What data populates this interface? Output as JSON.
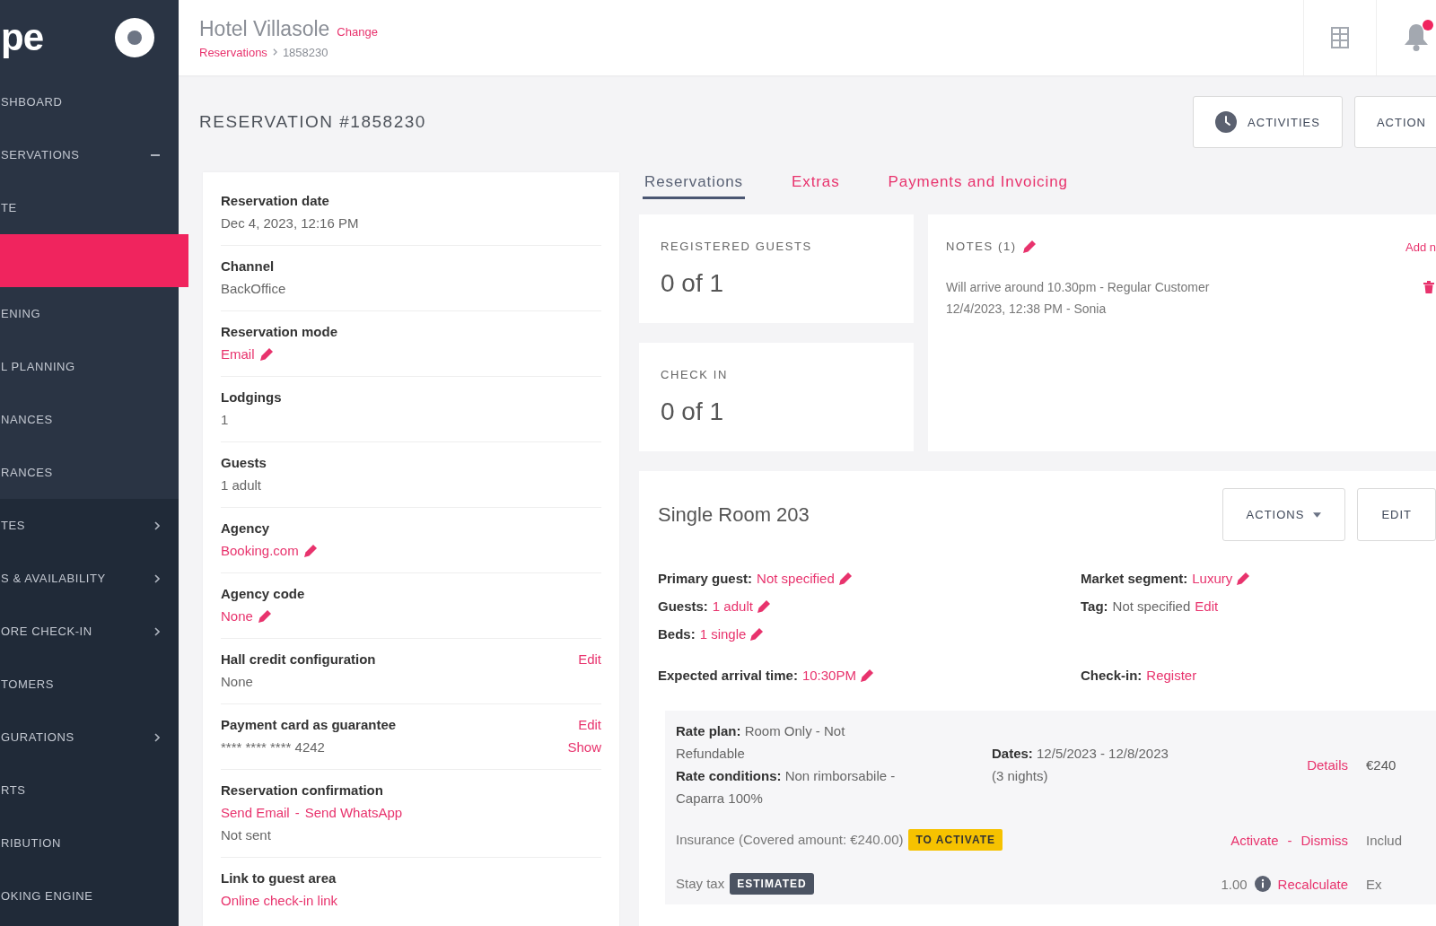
{
  "sidebar": {
    "logo": "pe",
    "items": [
      {
        "label": "SHBOARD",
        "kind": "link",
        "selected": false
      },
      {
        "label": "SERVATIONS",
        "kind": "group",
        "expanded": true,
        "selected": false,
        "children": [
          {
            "label": "TE",
            "selected": false
          },
          {
            "selected": true
          },
          {
            "label": "ENING",
            "selected": false
          },
          {
            "label": "L PLANNING",
            "selected": false
          },
          {
            "label": "NANCES",
            "selected": false
          },
          {
            "label": "RANCES",
            "selected": false
          }
        ]
      },
      {
        "label": "TES",
        "kind": "group",
        "expanded": false,
        "selected": false
      },
      {
        "label": "S & AVAILABILITY",
        "kind": "group",
        "expanded": false,
        "selected": false
      },
      {
        "label": "ORE CHECK-IN",
        "kind": "group",
        "expanded": false,
        "selected": false
      },
      {
        "label": "TOMERS",
        "kind": "link",
        "selected": false
      },
      {
        "label": "GURATIONS",
        "kind": "group",
        "expanded": false,
        "selected": false
      },
      {
        "label": "RTS",
        "kind": "link",
        "selected": false
      },
      {
        "label": "RIBUTION",
        "kind": "link",
        "selected": false
      },
      {
        "label": "OKING ENGINE",
        "kind": "link",
        "selected": false
      }
    ]
  },
  "header": {
    "hotel_name": "Hotel Villasole",
    "change_link": "Change",
    "breadcrumb": [
      {
        "label": "Reservations",
        "kind": "link"
      },
      {
        "label": "1858230",
        "kind": "current"
      }
    ]
  },
  "title": "RESERVATION #1858230",
  "title_buttons": [
    {
      "label": "ACTIVITIES",
      "kind": "activities"
    },
    {
      "label": "ACTION",
      "kind": "actions"
    }
  ],
  "details": [
    {
      "label": "Reservation date",
      "value": "Dec 4, 2023, 12:16 PM",
      "kind": "text"
    },
    {
      "label": "Channel",
      "value": "BackOffice",
      "kind": "text"
    },
    {
      "label": "Reservation mode",
      "value": "Email",
      "kind": "editable"
    },
    {
      "label": "Lodgings",
      "value": "1",
      "kind": "text"
    },
    {
      "label": "Guests",
      "value": "1 adult",
      "kind": "text"
    },
    {
      "label": "Agency",
      "value": "Booking.com",
      "kind": "editable"
    },
    {
      "label": "Agency code",
      "value": "None",
      "kind": "editable"
    },
    {
      "label": "Hall credit configuration",
      "value": "None",
      "kind": "text",
      "actions": [
        "Edit"
      ]
    },
    {
      "label": "Payment card as guarantee",
      "value": "**** **** **** 4242",
      "kind": "text",
      "actions": [
        "Edit",
        "Show"
      ]
    },
    {
      "label": "Reservation confirmation",
      "kind": "links",
      "links": [
        "Send Email",
        "Send WhatsApp"
      ],
      "link_separator": "-",
      "value": "Not sent"
    },
    {
      "label": "Link to guest area",
      "kind": "links",
      "links": [
        "Online check-in link"
      ]
    }
  ],
  "tabs": [
    {
      "label": "Reservations",
      "selected": true
    },
    {
      "label": "Extras",
      "selected": false
    },
    {
      "label": "Payments and Invoicing",
      "selected": false
    }
  ],
  "stats": [
    {
      "title": "REGISTERED GUESTS",
      "value": "0 of 1"
    },
    {
      "title": "CHECK IN",
      "value": "0 of 1"
    }
  ],
  "notes": {
    "title": "NOTES (1)",
    "add_link": "Add n",
    "items": [
      {
        "text": "Will arrive around 10.30pm - Regular Customer",
        "meta": "12/4/2023, 12:38 PM - Sonia"
      }
    ]
  },
  "room": {
    "title": "Single Room 203",
    "buttons": [
      {
        "label": "ACTIONS",
        "kind": "dropdown"
      },
      {
        "label": "EDIT",
        "kind": "plain"
      }
    ],
    "fields": [
      [
        {
          "label": "Primary guest:",
          "value": "Not specified",
          "kind": "editable"
        },
        {
          "label": "Guests:",
          "value": "1 adult",
          "kind": "editable"
        },
        {
          "label": "Beds:",
          "value": "1 single",
          "kind": "editable"
        }
      ],
      [
        {
          "label": "Market segment:",
          "value": "Luxury",
          "kind": "editable"
        },
        {
          "label": "Tag:",
          "value": "Not specified",
          "kind": "text",
          "action": "Edit"
        }
      ]
    ],
    "arrival": [
      {
        "label": "Expected arrival time:",
        "value": "10:30PM",
        "kind": "editable"
      },
      {
        "label": "Check-in:",
        "value": "Register",
        "kind": "link"
      }
    ],
    "rate_plan": "**Rate plan:** Room Only - Not Refundable",
    "rate_conditions": "**Rate conditions:** Non rimborsabile - Caparra 100%",
    "dates": "**Dates:** 12/5/2023 - 12/8/2023 (3 nights)",
    "details_link": "Details",
    "price": "€240",
    "insurance": {
      "text": "Insurance (Covered amount: €240.00)",
      "badge": "TO ACTIVATE",
      "links": [
        "Activate",
        "Dismiss"
      ],
      "link_separator": "-",
      "status": "Includ"
    },
    "stay_tax": {
      "label": "Stay tax",
      "badge": "ESTIMATED",
      "amount": "1.00",
      "link": "Recalculate",
      "total": "Ex"
    }
  }
}
